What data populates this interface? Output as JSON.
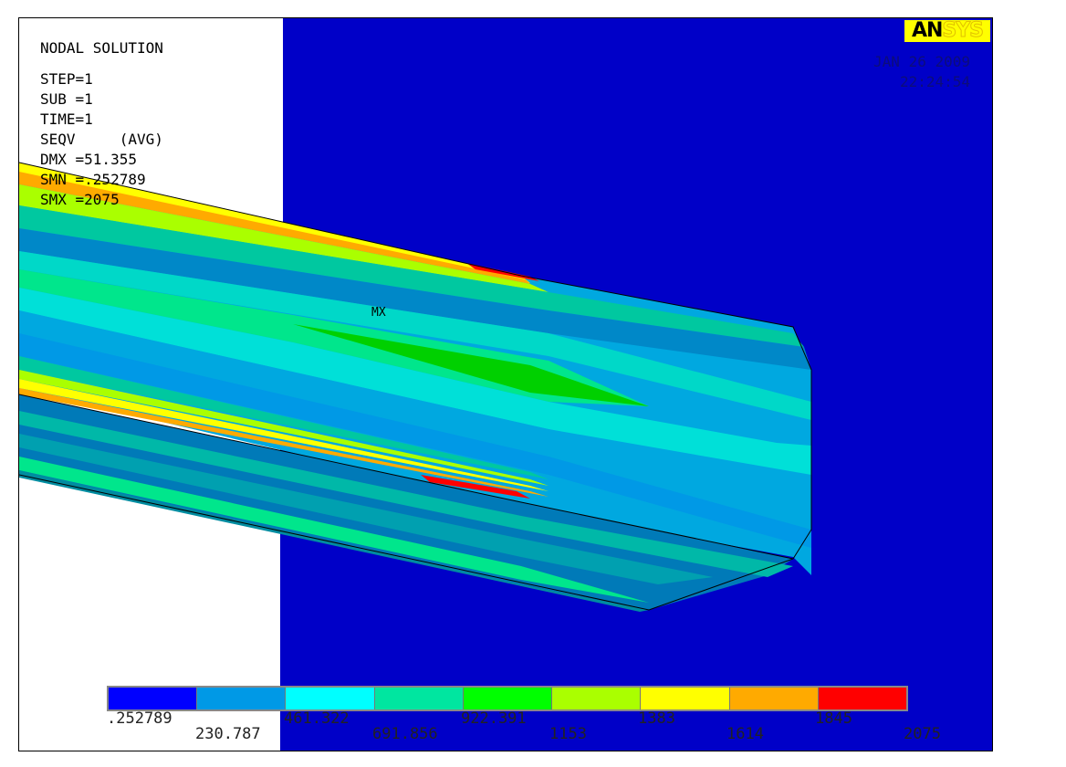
{
  "logo": {
    "part1": "AN",
    "part2": "SYS"
  },
  "info": {
    "line1": "NODAL SOLUTION",
    "step": "STEP=1",
    "sub": "SUB =1",
    "time": "TIME=1",
    "seqv": "SEQV     (AVG)",
    "dmx": "DMX =51.355",
    "smn": "SMN =.252789",
    "smx": "SMX =2075"
  },
  "stamp": {
    "date": "JAN 26 2009",
    "time": "22:24:54"
  },
  "plot": {
    "max_marker": "MX"
  },
  "legend": {
    "colors": [
      "#0000ff",
      "#0099e6",
      "#00ffff",
      "#00e6a0",
      "#00ff00",
      "#aaff00",
      "#ffff00",
      "#ffaa00",
      "#ff0000"
    ],
    "lower_ticks": [
      ".252789",
      "461.322",
      "922.391",
      "1383",
      "1845"
    ],
    "upper_ticks": [
      "230.787",
      "691.856",
      "1153",
      "1614",
      "2075"
    ]
  },
  "palette": {
    "background_blue": "#0000c8",
    "frame": "#ffffff"
  }
}
